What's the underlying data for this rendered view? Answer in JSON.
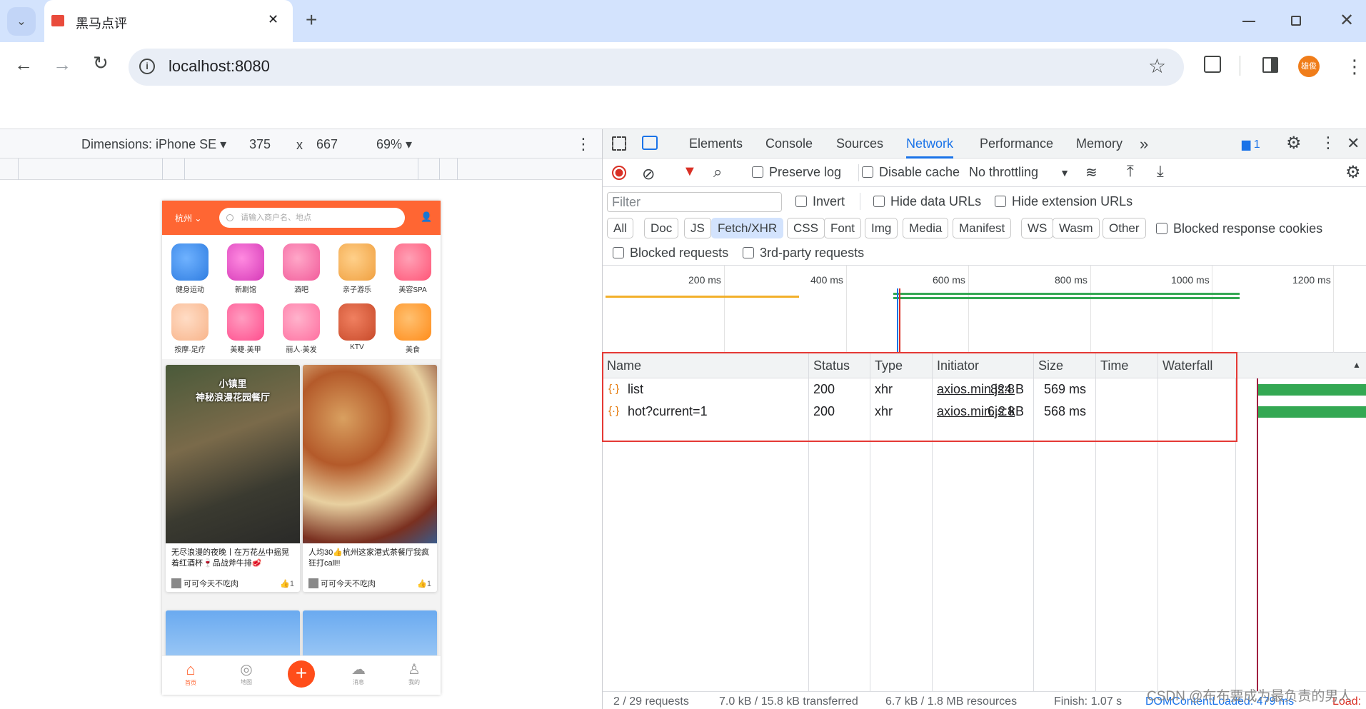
{
  "browser": {
    "tab_title": "黑马点评",
    "url": "localhost:8080",
    "avatar_label": "雄俊",
    "new_tab": "+",
    "close_tab": "✕"
  },
  "device_toolbar": {
    "dimensions_label": "Dimensions: iPhone SE",
    "width": "375",
    "times": "x",
    "height": "667",
    "zoom": "69%"
  },
  "phone": {
    "city": "杭州",
    "search_placeholder": "请输入商户名、地点",
    "categories": [
      {
        "label": "健身运动",
        "color": "#2f7de1"
      },
      {
        "label": "新剧馆",
        "color": "#d63ab8"
      },
      {
        "label": "酒吧",
        "color": "#f25c9b"
      },
      {
        "label": "亲子游乐",
        "color": "#f0a040"
      },
      {
        "label": "美容SPA",
        "color": "#ff5577"
      },
      {
        "label": "按摩·足疗",
        "color": "#f8b48a"
      },
      {
        "label": "美睫·美甲",
        "color": "#ff4d8d"
      },
      {
        "label": "丽人·美发",
        "color": "#ff6fa0"
      },
      {
        "label": "KTV",
        "color": "#c84a2a"
      },
      {
        "label": "美食",
        "color": "#ff8c1a"
      }
    ],
    "cards": [
      {
        "overlay": "小镇里\n神秘浪漫花园餐厅",
        "title": "无尽浪漫的夜晚丨在万花丛中摇晃着红酒杯🍷品战斧牛排🥩",
        "author": "可可今天不吃肉",
        "likes": "1"
      },
      {
        "overlay": "",
        "title": "人均30👍杭州这家港式茶餐厅我疯狂打call!!",
        "author": "可可今天不吃肉",
        "likes": "1"
      }
    ],
    "tabbar": [
      "首页",
      "地图",
      "",
      "消息",
      "我的"
    ]
  },
  "devtools": {
    "tabs": [
      "Elements",
      "Console",
      "Sources",
      "Network",
      "Performance",
      "Memory"
    ],
    "active_tab": "Network",
    "more_tabs": "»",
    "issues_count": "1",
    "preserve_log": "Preserve log",
    "disable_cache": "Disable cache",
    "throttling": "No throttling",
    "filter_placeholder": "Filter",
    "invert": "Invert",
    "hide_data_urls": "Hide data URLs",
    "hide_extension_urls": "Hide extension URLs",
    "filter_types": [
      "All",
      "Doc",
      "JS",
      "Fetch/XHR",
      "CSS",
      "Font",
      "Img",
      "Media",
      "Manifest",
      "WS",
      "Wasm",
      "Other"
    ],
    "active_filter": "Fetch/XHR",
    "blocked_response_cookies": "Blocked response cookies",
    "blocked_requests": "Blocked requests",
    "third_party_requests": "3rd-party requests",
    "timeline_labels": [
      "200 ms",
      "400 ms",
      "600 ms",
      "800 ms",
      "1000 ms",
      "1200 ms"
    ],
    "columns": [
      "Name",
      "Status",
      "Type",
      "Initiator",
      "Size",
      "Time",
      "Waterfall"
    ],
    "requests": [
      {
        "name": "list",
        "status": "200",
        "type": "xhr",
        "initiator": "axios.min.js:8",
        "size": "824 B",
        "time": "569 ms"
      },
      {
        "name": "hot?current=1",
        "status": "200",
        "type": "xhr",
        "initiator": "axios.min.js:8",
        "size": "6.2 kB",
        "time": "568 ms"
      }
    ],
    "status_bar": [
      "2 / 29 requests",
      "7.0 kB / 15.8 kB transferred",
      "6.7 kB / 1.8 MB resources",
      "Finish: 1.07 s",
      "DOMContentLoaded: 479 ms",
      "Load:"
    ],
    "colors": {
      "accent": "#1a73e8",
      "waterfall": "#34a853",
      "highlight": "#e53935"
    }
  },
  "watermark": "CSDN @布布要成为最负责的男人"
}
